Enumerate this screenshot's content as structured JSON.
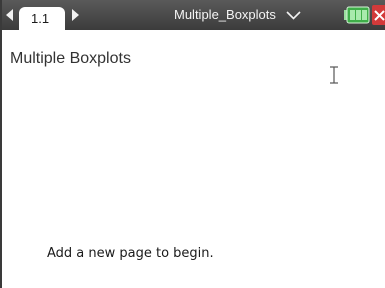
{
  "toolbar": {
    "tab_label": "1.1",
    "document_title": "Multiple_Boxplots",
    "icons": {
      "back": "nav-left-arrow",
      "forward": "nav-right-arrow",
      "menu": "chevron-down",
      "battery": "battery",
      "close": "close"
    }
  },
  "page": {
    "title": "Multiple Boxplots",
    "message": "Add a new page to begin."
  },
  "colors": {
    "toolbar_background": "#4a4a4a",
    "tab_background": "#ffffff",
    "battery_green": "#3fae49",
    "close_red": "#d23a3a"
  }
}
